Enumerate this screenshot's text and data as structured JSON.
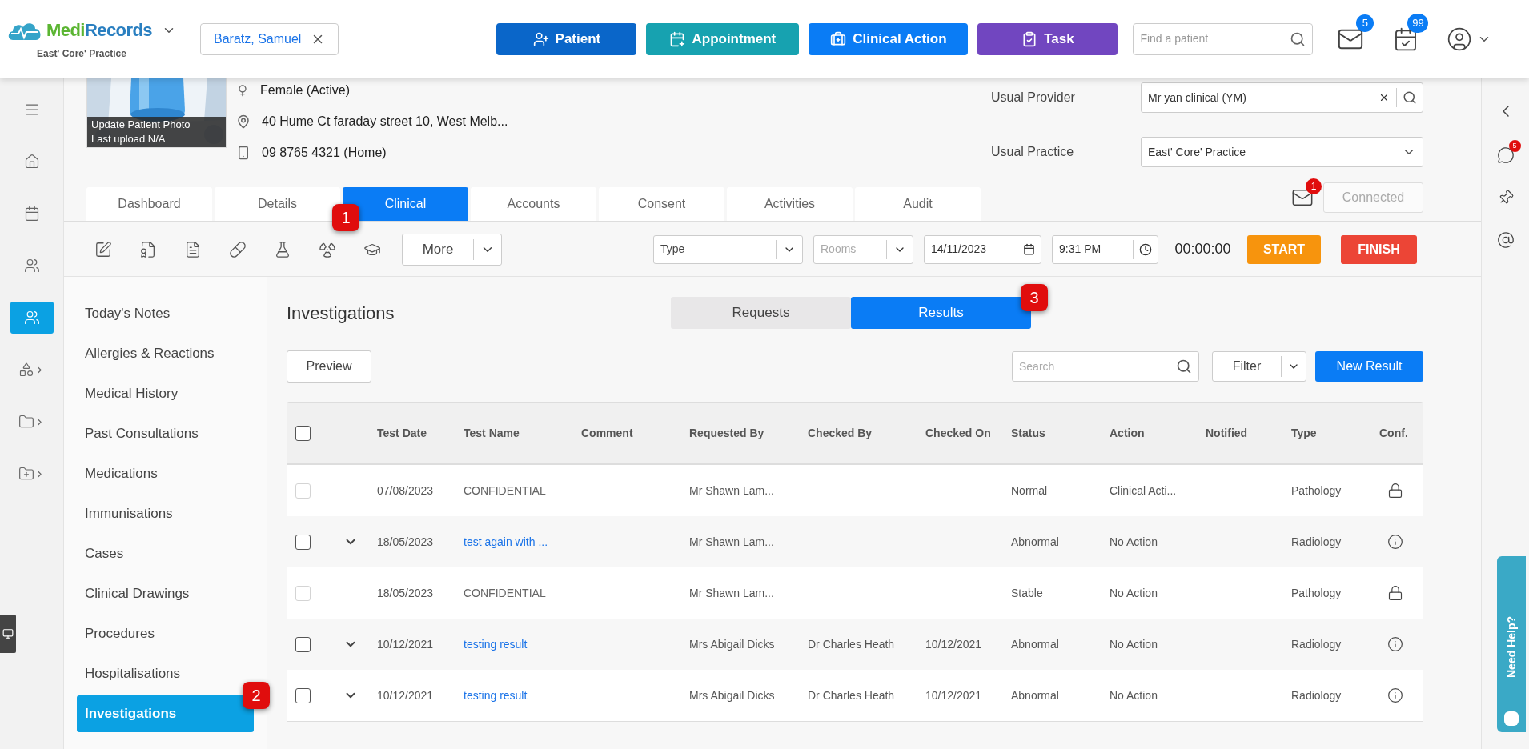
{
  "header": {
    "logo": [
      "Medi",
      "Records"
    ],
    "practice": "East' Core' Practice",
    "patient_chip": "Baratz, Samuel",
    "actions": [
      {
        "label": "Patient",
        "kind": "patient",
        "color": "#0a66c9"
      },
      {
        "label": "Appointment",
        "kind": "appointment",
        "color": "#17a2b0"
      },
      {
        "label": "Clinical Action",
        "kind": "clinical",
        "color": "#0a7cf5"
      },
      {
        "label": "Task",
        "kind": "task",
        "color": "#7146c0"
      }
    ],
    "search": {
      "placeholder": "Find a patient"
    },
    "mail_badge": "5",
    "calendar_badge": "99"
  },
  "rail": [
    {
      "kind": "collapse",
      "selected": false
    },
    {
      "kind": "home",
      "selected": false
    },
    {
      "kind": "calendar",
      "selected": false
    },
    {
      "kind": "people",
      "selected": false
    },
    {
      "kind": "patients",
      "selected": true
    },
    {
      "kind": "shapes",
      "selected": false
    },
    {
      "kind": "folder",
      "selected": false
    },
    {
      "kind": "folder-add",
      "selected": false
    }
  ],
  "patient": {
    "photo_caption": [
      "Update Patient Photo",
      "Last upload N/A"
    ],
    "gender": "Female (Active)",
    "address": "40 Hume Ct faraday street 10, West Melb...",
    "phone": "09 8765 4321 (Home)",
    "provider": {
      "label": "Usual Provider",
      "value": "Mr yan clinical (YM)"
    },
    "practice": {
      "label": "Usual Practice",
      "value": "East' Core' Practice"
    },
    "message_badge": "1",
    "connected": "Connected"
  },
  "tabs": [
    {
      "label": "Dashboard",
      "selected": false
    },
    {
      "label": "Details",
      "selected": false
    },
    {
      "label": "Clinical",
      "selected": true
    },
    {
      "label": "Accounts",
      "selected": false
    },
    {
      "label": "Consent",
      "selected": false
    },
    {
      "label": "Activities",
      "selected": false
    },
    {
      "label": "Audit",
      "selected": false
    }
  ],
  "toolbar": {
    "more": "More",
    "type": {
      "placeholder": "Type"
    },
    "rooms": {
      "placeholder": "Rooms"
    },
    "date": "14/11/2023",
    "time": "9:31 PM",
    "timer": "00:00:00",
    "start": "START",
    "finish": "FINISH"
  },
  "sidebar": {
    "items": [
      {
        "label": "Today's Notes",
        "selected": false
      },
      {
        "label": "Allergies & Reactions",
        "selected": false
      },
      {
        "label": "Medical History",
        "selected": false
      },
      {
        "label": "Past Consultations",
        "selected": false
      },
      {
        "label": "Medications",
        "selected": false
      },
      {
        "label": "Immunisations",
        "selected": false
      },
      {
        "label": "Cases",
        "selected": false
      },
      {
        "label": "Clinical Drawings",
        "selected": false
      },
      {
        "label": "Procedures",
        "selected": false
      },
      {
        "label": "Hospitalisations",
        "selected": false
      },
      {
        "label": "Investigations",
        "selected": true
      }
    ]
  },
  "content": {
    "title": "Investigations",
    "segments": [
      {
        "label": "Requests",
        "selected": false
      },
      {
        "label": "Results",
        "selected": true
      }
    ],
    "preview": "Preview",
    "search": {
      "placeholder": "Search"
    },
    "filter": "Filter",
    "new_result": "New Result",
    "table": {
      "select_all": {
        "checked": false
      },
      "columns": [
        "Test Date",
        "Test Name",
        "Comment",
        "Requested By",
        "Checked By",
        "Checked On",
        "Status",
        "Action",
        "Notified",
        "Type",
        "Conf."
      ],
      "rows": [
        {
          "confidential": true,
          "checked": false,
          "test_date": "07/08/2023",
          "test_name": "CONFIDENTIAL",
          "requested_by": "Mr Shawn Lam...",
          "status": "Normal",
          "action": "Clinical Acti...",
          "type": "Pathology"
        },
        {
          "confidential": false,
          "checked": false,
          "test_date": "18/05/2023",
          "test_name": "test again with ...",
          "requested_by": "Mr Shawn Lam...",
          "status": "Abnormal",
          "action": "No Action",
          "type": "Radiology"
        },
        {
          "confidential": true,
          "checked": false,
          "test_date": "18/05/2023",
          "test_name": "CONFIDENTIAL",
          "requested_by": "Mr Shawn Lam...",
          "status": "Stable",
          "action": "No Action",
          "type": "Pathology"
        },
        {
          "confidential": false,
          "checked": false,
          "test_date": "10/12/2021",
          "test_name": "testing result",
          "requested_by": "Mrs Abigail Dicks",
          "checked_by": "Dr Charles Heath",
          "checked_on": "10/12/2021",
          "status": "Abnormal",
          "action": "No Action",
          "type": "Radiology"
        },
        {
          "confidential": false,
          "checked": false,
          "test_date": "10/12/2021",
          "test_name": "testing result",
          "requested_by": "Mrs Abigail Dicks",
          "checked_by": "Dr Charles Heath",
          "checked_on": "10/12/2021",
          "status": "Abnormal",
          "action": "No Action",
          "type": "Radiology"
        }
      ]
    }
  },
  "right_rail": {
    "chat_badge": "5",
    "help": "Need Help?"
  },
  "callouts": [
    "1",
    "2",
    "3"
  ]
}
